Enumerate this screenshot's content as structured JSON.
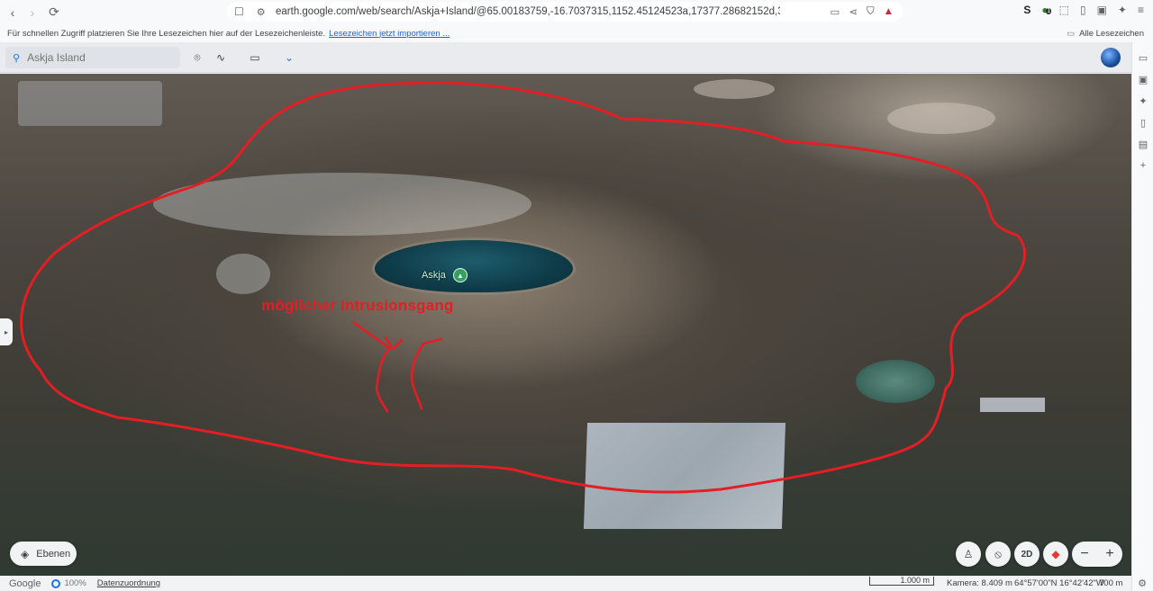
{
  "browser": {
    "url": "earth.google.com/web/search/Askja+Island/@65.00183759,-16.7037315,1152.45124523a,17377.28682152d,35y,3.71185291h,65.3871878...",
    "bookmarks_hint": "Für schnellen Zugriff platzieren Sie Ihre Lesezeichen hier auf der Lesezeichenleiste.",
    "bookmarks_link": "Lesezeichen jetzt importieren ...",
    "all_bookmarks": "Alle Lesezeichen",
    "ext_badge": "1"
  },
  "earth": {
    "search_placeholder": "Askja Island",
    "place_label": "Askja",
    "annotation": "möglicher Intrusionsgang",
    "layers_label": "Ebenen",
    "mode_2d": "2D",
    "zoom_out": "−",
    "zoom_in": "+"
  },
  "status": {
    "logo": "Google",
    "percent": "100%",
    "attribution": "Datenzuordnung",
    "scale": "1.000 m",
    "camera": "Kamera: 8.409 m",
    "coords": "64°57'00\"N 16°42'42\"W",
    "elevation": "700 m"
  },
  "colors": {
    "annotation_red": "#e31e24",
    "accent_blue": "#1a73e8",
    "pin_green": "#34a05f"
  }
}
